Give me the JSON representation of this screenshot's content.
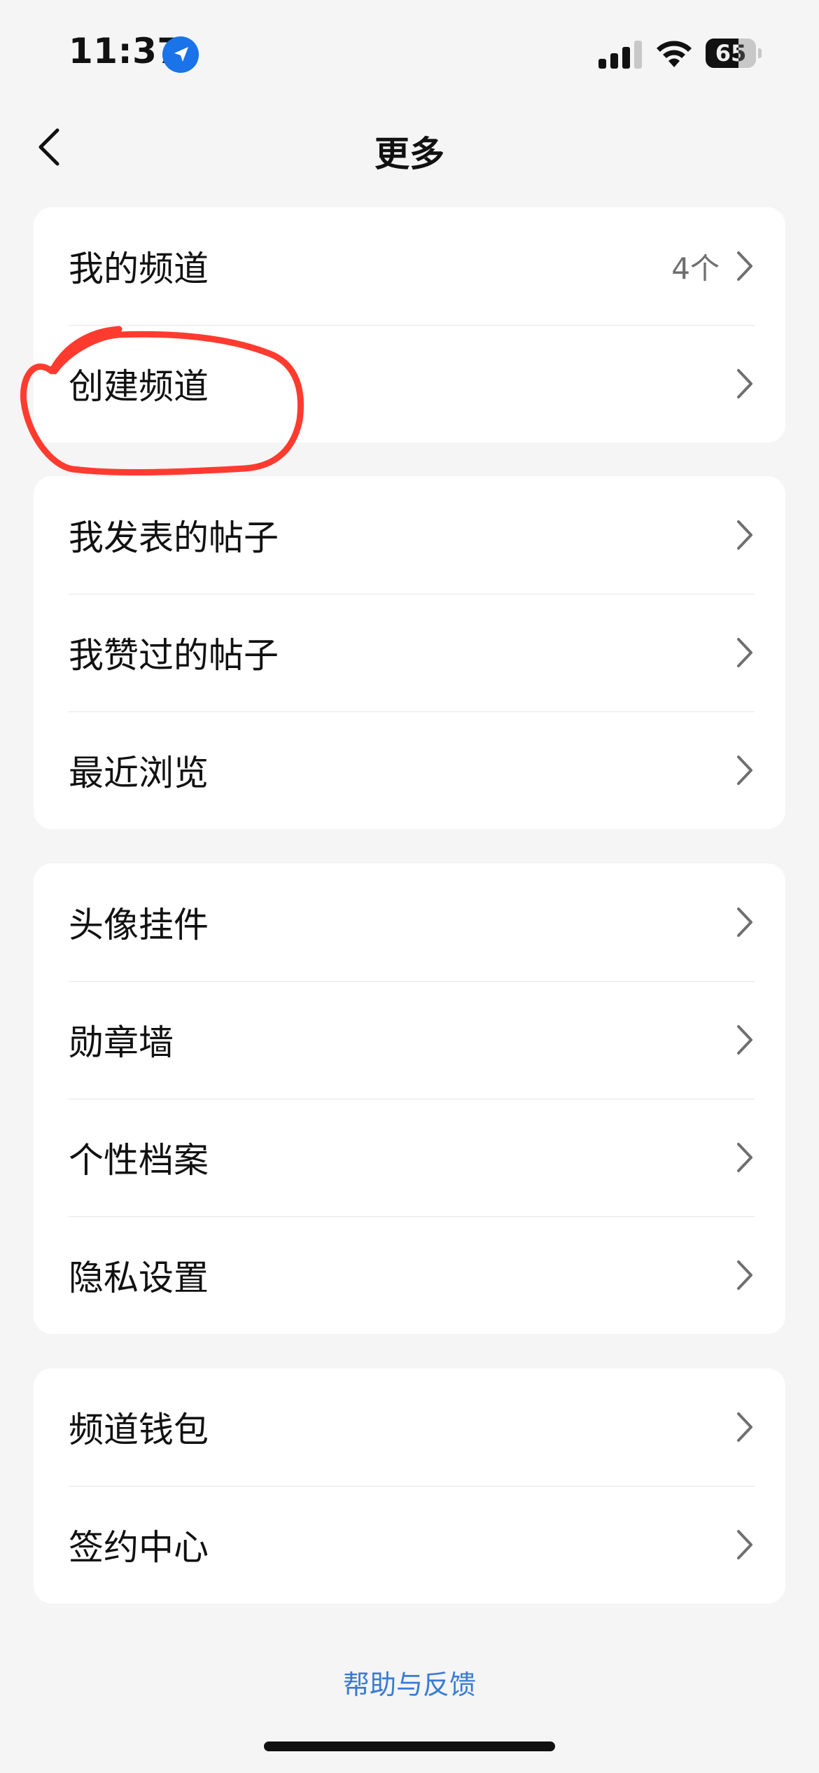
{
  "status_bar": {
    "time": "11:37",
    "battery_percent": "65",
    "battery_level": 0.65,
    "icons": [
      "location-arrow-icon",
      "cellular-signal-icon",
      "wifi-icon",
      "battery-icon"
    ]
  },
  "nav": {
    "title": "更多",
    "back_icon": "chevron-left-icon"
  },
  "sections": [
    {
      "items": [
        {
          "label": "我的频道",
          "value": "4个"
        },
        {
          "label": "创建频道",
          "value": ""
        }
      ]
    },
    {
      "items": [
        {
          "label": "我发表的帖子",
          "value": ""
        },
        {
          "label": "我赞过的帖子",
          "value": ""
        },
        {
          "label": "最近浏览",
          "value": ""
        }
      ]
    },
    {
      "items": [
        {
          "label": "头像挂件",
          "value": ""
        },
        {
          "label": "勋章墙",
          "value": ""
        },
        {
          "label": "个性档案",
          "value": ""
        },
        {
          "label": "隐私设置",
          "value": ""
        }
      ]
    },
    {
      "items": [
        {
          "label": "频道钱包",
          "value": ""
        },
        {
          "label": "签约中心",
          "value": ""
        }
      ]
    }
  ],
  "footer": {
    "help_link": "帮助与反馈"
  },
  "colors": {
    "background": "#f5f5f5",
    "card": "#ffffff",
    "link": "#3a7bd5",
    "annotation": "#ff3b30"
  }
}
